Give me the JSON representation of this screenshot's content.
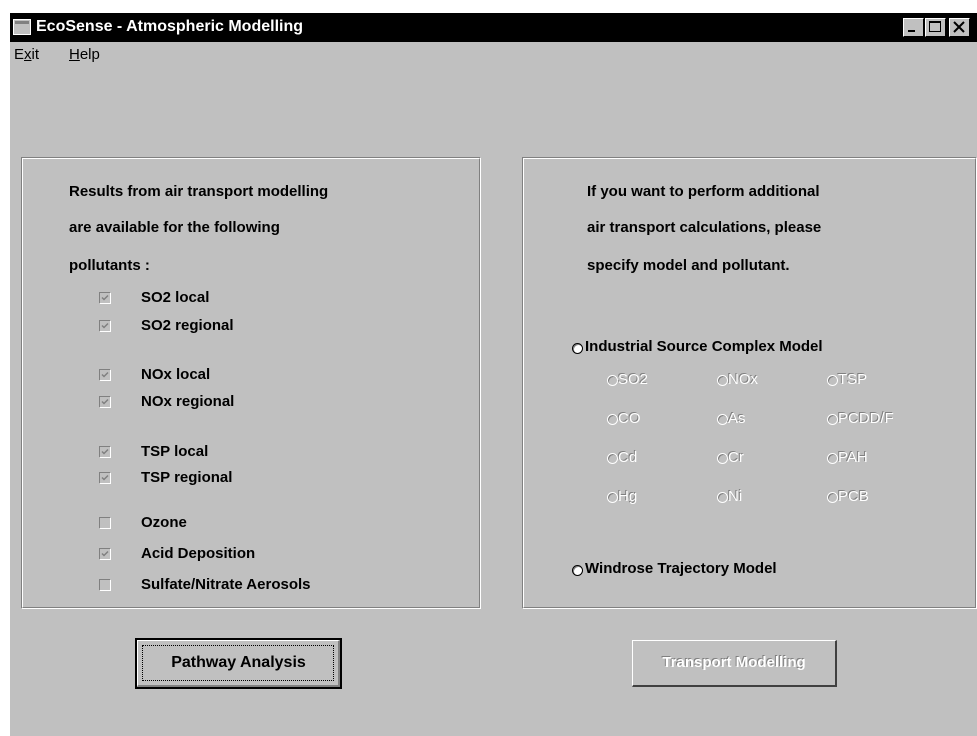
{
  "window": {
    "title": "EcoSense - Atmospheric Modelling"
  },
  "menu": {
    "exit": "Exit",
    "help": "Help"
  },
  "left_panel": {
    "intro_lines": [
      "Results from air transport modelling",
      "are available for the following",
      "pollutants :"
    ],
    "checkboxes": [
      {
        "label": "SO2 local",
        "checked": true
      },
      {
        "label": "SO2 regional",
        "checked": true
      },
      {
        "label": "NOx local",
        "checked": true
      },
      {
        "label": "NOx regional",
        "checked": true
      },
      {
        "label": "TSP local",
        "checked": true
      },
      {
        "label": "TSP regional",
        "checked": true
      },
      {
        "label": "Ozone",
        "checked": false
      },
      {
        "label": "Acid Deposition",
        "checked": true
      },
      {
        "label": "Sulfate/Nitrate Aerosols",
        "checked": false
      }
    ]
  },
  "right_panel": {
    "intro_lines": [
      "If you want to perform additional",
      "air transport calculations, please",
      "specify model and pollutant."
    ],
    "models": {
      "isc": "Industrial Source Complex Model",
      "windrose": "Windrose Trajectory Model"
    },
    "pollutants": [
      [
        "SO2",
        "NOx",
        "TSP"
      ],
      [
        "CO",
        "As",
        "PCDD/F"
      ],
      [
        "Cd",
        "Cr",
        "PAH"
      ],
      [
        "Hg",
        "Ni",
        "PCB"
      ]
    ]
  },
  "buttons": {
    "pathway": "Pathway Analysis",
    "transport": "Transport Modelling"
  },
  "colors": {
    "face": "#c0c0c0",
    "titlebar": "#000000",
    "disabled_text": "#ffffff"
  }
}
